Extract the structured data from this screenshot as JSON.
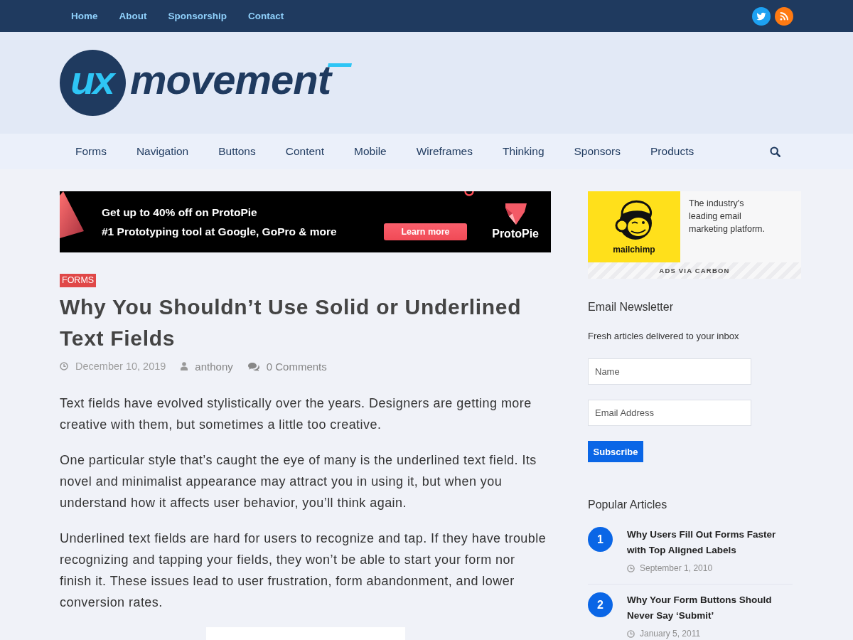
{
  "top_bar": {
    "links": [
      "Home",
      "About",
      "Sponsorship",
      "Contact"
    ],
    "social": [
      {
        "kind": "twitter",
        "color": "#1da1f2"
      },
      {
        "kind": "rss",
        "color": "#ff7a12"
      }
    ]
  },
  "logo": {
    "badge": "ux",
    "wordmark": "movement"
  },
  "category_nav": {
    "items": [
      "Forms",
      "Navigation",
      "Buttons",
      "Content",
      "Mobile",
      "Wireframes",
      "Thinking",
      "Sponsors",
      "Products"
    ]
  },
  "banner_ad": {
    "headline": "Get up to 40% off on ProtoPie",
    "tagline": "#1 Prototyping tool at Google, GoPro & more",
    "button": "Learn more",
    "brand": "ProtoPie"
  },
  "article": {
    "category": "FORMS",
    "title": "Why You Shouldn’t Use Solid or Underlined Text Fields",
    "meta": [
      {
        "kind": "date",
        "text": "December 10, 2019"
      },
      {
        "kind": "author",
        "text": "anthony"
      },
      {
        "kind": "comments",
        "text": "0 Comments"
      }
    ],
    "paragraphs": [
      "Text fields have evolved stylistically over the years. Designers are getting more creative with them, but sometimes a little too creative.",
      "One particular style that’s caught the eye of many is the underlined text field. Its novel and minimalist appearance may attract you in using it, but when you understand how it affects user behavior, you’ll think again.",
      "Underlined text fields are hard for users to recognize and tap. If they have trouble recognizing and tapping your fields, they won’t be able to start your form nor finish it. These issues lead to user frustration, form abandonment, and lower conversion rates."
    ]
  },
  "sidebar": {
    "carbon_ad": {
      "brand": "mailchimp",
      "text": "The industry's leading email marketing platform.",
      "footer": "ADS VIA CARBON"
    },
    "newsletter": {
      "title": "Email Newsletter",
      "description": "Fresh articles delivered to your inbox",
      "fields": [
        {
          "placeholder": "Name"
        },
        {
          "placeholder": "Email Address"
        }
      ],
      "button": "Subscribe"
    },
    "popular": {
      "title": "Popular Articles",
      "items": [
        {
          "rank": "1",
          "title": "Why Users Fill Out Forms Faster with Top Aligned Labels",
          "date": "September 1, 2010"
        },
        {
          "rank": "2",
          "title": "Why Your Form Buttons Should Never Say ‘Submit’",
          "date": "January 5, 2011"
        }
      ]
    }
  }
}
